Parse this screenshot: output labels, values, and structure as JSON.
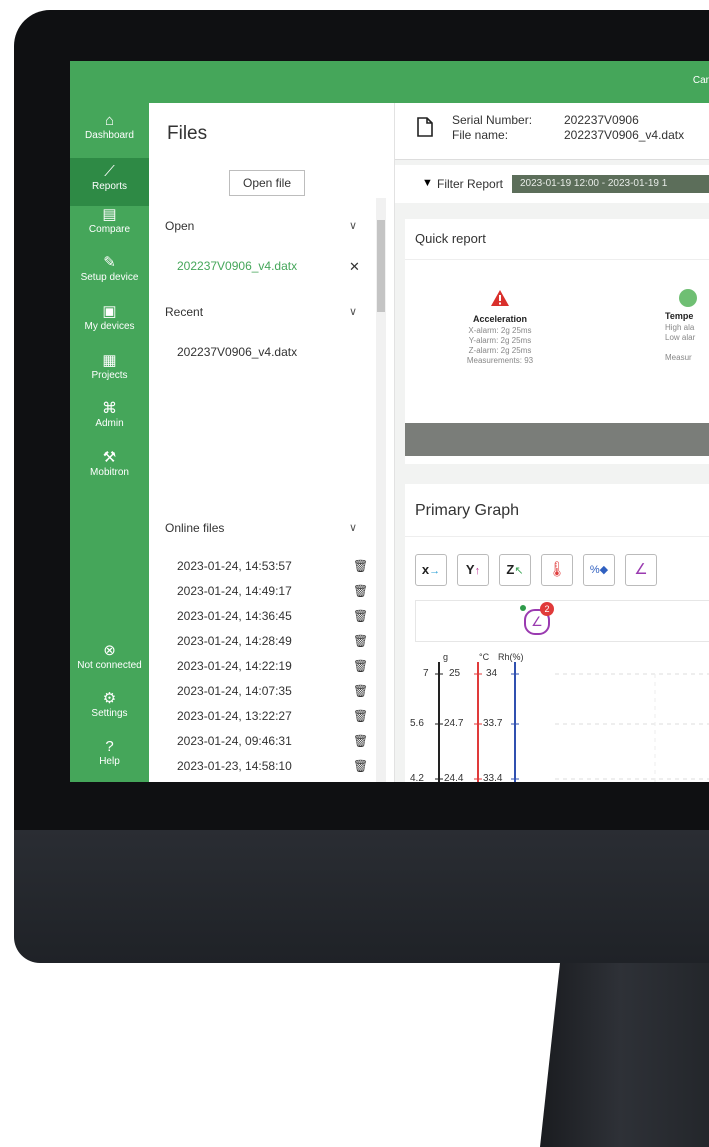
{
  "topbar": {
    "user_text": "Car"
  },
  "sidebar": {
    "items": [
      {
        "label": "Dashboard",
        "icon": "home-icon"
      },
      {
        "label": "Reports",
        "icon": "chart-icon"
      },
      {
        "label": "Compare",
        "icon": "copy-icon"
      },
      {
        "label": "Setup device",
        "icon": "edit-icon"
      },
      {
        "label": "My devices",
        "icon": "list-icon"
      },
      {
        "label": "Projects",
        "icon": "calendar-icon"
      },
      {
        "label": "Admin",
        "icon": "org-icon"
      },
      {
        "label": "Mobitron",
        "icon": "wrench-icon"
      }
    ],
    "bottom": [
      {
        "label": "Not connected",
        "icon": "disconnected-icon"
      },
      {
        "label": "Settings",
        "icon": "gear-icon"
      },
      {
        "label": "Help",
        "icon": "help-icon"
      }
    ]
  },
  "files": {
    "title": "Files",
    "open_file_button": "Open file",
    "open_section": "Open",
    "open_file": "202237V0906_v4.datx",
    "recent_section": "Recent",
    "recent_file": "202237V0906_v4.datx",
    "online_section": "Online files",
    "online_files": [
      "2023-01-24, 14:53:57",
      "2023-01-24, 14:49:17",
      "2023-01-24, 14:36:45",
      "2023-01-24, 14:28:49",
      "2023-01-24, 14:22:19",
      "2023-01-24, 14:07:35",
      "2023-01-24, 13:22:27",
      "2023-01-24, 09:46:31",
      "2023-01-23, 14:58:10"
    ]
  },
  "header": {
    "serial_label": "Serial Number:",
    "serial_value": "202237V0906",
    "file_label": "File name:",
    "file_value": "202237V0906_v4.datx"
  },
  "filter": {
    "label": "Filter Report",
    "range": "2023-01-19 12:00  -  2023-01-19 1"
  },
  "quick_report": {
    "title": "Quick report",
    "items": [
      {
        "title": "Acceleration",
        "lines": [
          "X-alarm: 2g 25ms",
          "Y-alarm: 2g 25ms",
          "Z-alarm: 2g 25ms",
          "Measurements: 93"
        ],
        "status_color": "#d9302c"
      },
      {
        "title": "Tempe",
        "lines": [
          "High ala",
          "Low alar",
          "",
          "Measur"
        ],
        "status_color": "#6fbf73"
      }
    ]
  },
  "primary_graph": {
    "title": "Primary Graph",
    "tools": [
      {
        "label": "X",
        "icon": "x-axis-icon",
        "color": "#2a9fd6"
      },
      {
        "label": "Y",
        "icon": "y-axis-icon",
        "color": "#c0359a"
      },
      {
        "label": "Z",
        "icon": "z-axis-icon",
        "color": "#3aa655"
      },
      {
        "label": "",
        "icon": "thermometer-icon",
        "color": "#e04040"
      },
      {
        "label": "%",
        "icon": "humidity-icon",
        "color": "#3060c0"
      },
      {
        "label": "",
        "icon": "angle-icon",
        "color": "#9a3ab0"
      }
    ],
    "badge_count": "2",
    "units": [
      "g",
      "°C",
      "Rh(%)"
    ],
    "axis_ticks": [
      [
        "7",
        "25",
        "34"
      ],
      [
        "5.6",
        "24.7",
        "33.7"
      ],
      [
        "4.2",
        "24.4",
        "33.4"
      ]
    ]
  }
}
